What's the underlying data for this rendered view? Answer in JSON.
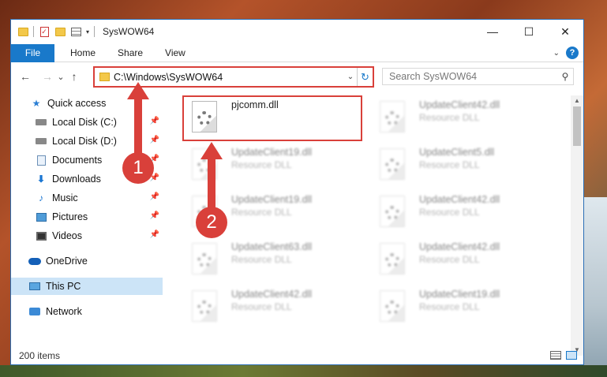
{
  "window": {
    "title": "SysWOW64",
    "controls": {
      "minimize": "—",
      "maximize": "☐",
      "close": "✕"
    }
  },
  "ribbon": {
    "tabs": [
      {
        "label": "File"
      },
      {
        "label": "Home"
      },
      {
        "label": "Share"
      },
      {
        "label": "View"
      }
    ],
    "help_label": "?"
  },
  "navigation": {
    "back": "←",
    "forward": "→",
    "recent": "⌄",
    "up": "↑",
    "address": "C:\\Windows\\SysWOW64",
    "refresh": "↻",
    "search_placeholder": "Search SysWOW64"
  },
  "sidebar": {
    "items": [
      {
        "label": "Quick access",
        "icon": "star-icon"
      },
      {
        "label": "Local Disk (C:)",
        "icon": "drive-icon",
        "pinned": true
      },
      {
        "label": "Local Disk (D:)",
        "icon": "drive-icon",
        "pinned": true
      },
      {
        "label": "Documents",
        "icon": "documents-icon",
        "pinned": true
      },
      {
        "label": "Downloads",
        "icon": "downloads-icon",
        "pinned": true
      },
      {
        "label": "Music",
        "icon": "music-icon",
        "pinned": true
      },
      {
        "label": "Pictures",
        "icon": "pictures-icon",
        "pinned": true
      },
      {
        "label": "Videos",
        "icon": "videos-icon",
        "pinned": true
      },
      {
        "label": "OneDrive",
        "icon": "onedrive-icon"
      },
      {
        "label": "This PC",
        "icon": "this-pc-icon",
        "selected": true
      },
      {
        "label": "Network",
        "icon": "network-icon"
      }
    ]
  },
  "files": [
    {
      "name": "pjcomm.dll",
      "type": "",
      "highlighted": true
    },
    {
      "name": "UpdateClient42.dll",
      "type": "Resource DLL"
    },
    {
      "name": "UpdateClient19.dll",
      "type": "Resource DLL"
    },
    {
      "name": "UpdateClient5.dll",
      "type": "Resource DLL"
    },
    {
      "name": "UpdateClient19.dll",
      "type": "Resource DLL"
    },
    {
      "name": "UpdateClient42.dll",
      "type": "Resource DLL"
    },
    {
      "name": "UpdateClient63.dll",
      "type": "Resource DLL"
    },
    {
      "name": "UpdateClient42.dll",
      "type": "Resource DLL"
    },
    {
      "name": "UpdateClient42.dll",
      "type": "Resource DLL"
    },
    {
      "name": "UpdateClient19.dll",
      "type": "Resource DLL"
    }
  ],
  "status": {
    "item_count": "200 items"
  },
  "callouts": {
    "one": "1",
    "two": "2"
  },
  "colors": {
    "accent": "#1979ca",
    "highlight": "#d9403a",
    "selection": "#cce4f7"
  }
}
